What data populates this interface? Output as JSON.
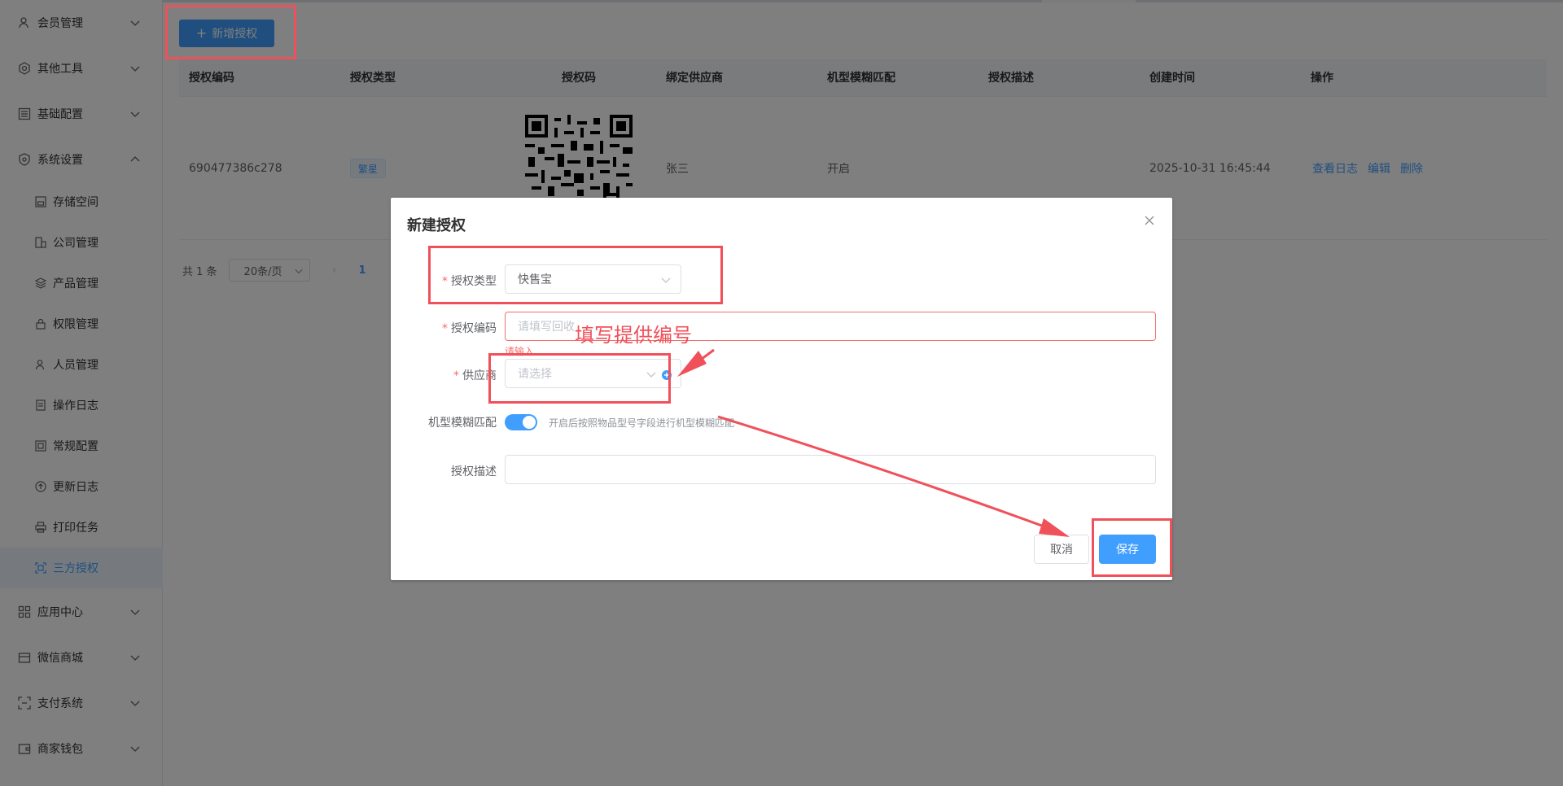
{
  "sidebar": {
    "groups_top": [
      {
        "label": "会员管理",
        "icon": "user-icon"
      },
      {
        "label": "其他工具",
        "icon": "gear-icon"
      },
      {
        "label": "基础配置",
        "icon": "config-icon"
      },
      {
        "label": "系统设置",
        "icon": "shield-icon"
      }
    ],
    "sub_items": [
      {
        "label": "存储空间",
        "icon": "storage-icon"
      },
      {
        "label": "公司管理",
        "icon": "building-icon"
      },
      {
        "label": "产品管理",
        "icon": "layers-icon"
      },
      {
        "label": "权限管理",
        "icon": "lock-icon"
      },
      {
        "label": "人员管理",
        "icon": "person-icon"
      },
      {
        "label": "操作日志",
        "icon": "log-icon"
      },
      {
        "label": "常规配置",
        "icon": "settings-icon"
      },
      {
        "label": "更新日志",
        "icon": "update-icon"
      },
      {
        "label": "打印任务",
        "icon": "printer-icon"
      },
      {
        "label": "三方授权",
        "icon": "scan-icon"
      }
    ],
    "groups_bottom": [
      {
        "label": "应用中心",
        "icon": "apps-icon"
      },
      {
        "label": "微信商城",
        "icon": "shop-icon"
      },
      {
        "label": "支付系统",
        "icon": "pay-icon"
      },
      {
        "label": "商家钱包",
        "icon": "wallet-icon"
      }
    ]
  },
  "toolbar": {
    "new_button": "新增授权"
  },
  "table": {
    "headers": [
      "授权编码",
      "授权类型",
      "授权码",
      "绑定供应商",
      "机型模糊匹配",
      "授权描述",
      "创建时间",
      "操作"
    ],
    "row": {
      "code": "690477386c278",
      "type": "繁星",
      "supplier": "张三",
      "fuzzy": "开启",
      "desc": "",
      "created": "2025-10-31 16:45:44",
      "actions": [
        "查看日志",
        "编辑",
        "删除"
      ]
    }
  },
  "pagination": {
    "total": "共 1 条",
    "page_size": "20条/页",
    "current": "1"
  },
  "dialog": {
    "title": "新建授权",
    "fields": {
      "type_label": "授权类型",
      "type_value": "快售宝",
      "code_label": "授权编码",
      "code_placeholder": "请填写回收",
      "code_error": "请输入",
      "supplier_label": "供应商",
      "supplier_placeholder": "请选择",
      "fuzzy_label": "机型模糊匹配",
      "fuzzy_hint": "开启后按照物品型号字段进行机型模糊匹配",
      "desc_label": "授权描述",
      "desc_value": ""
    },
    "cancel": "取消",
    "save": "保存"
  },
  "annotation": {
    "text": "填写提供编号",
    "color": "#f0505a"
  },
  "colors": {
    "primary": "#409eff",
    "error": "#f56c6c",
    "annotation": "#f0505a"
  }
}
